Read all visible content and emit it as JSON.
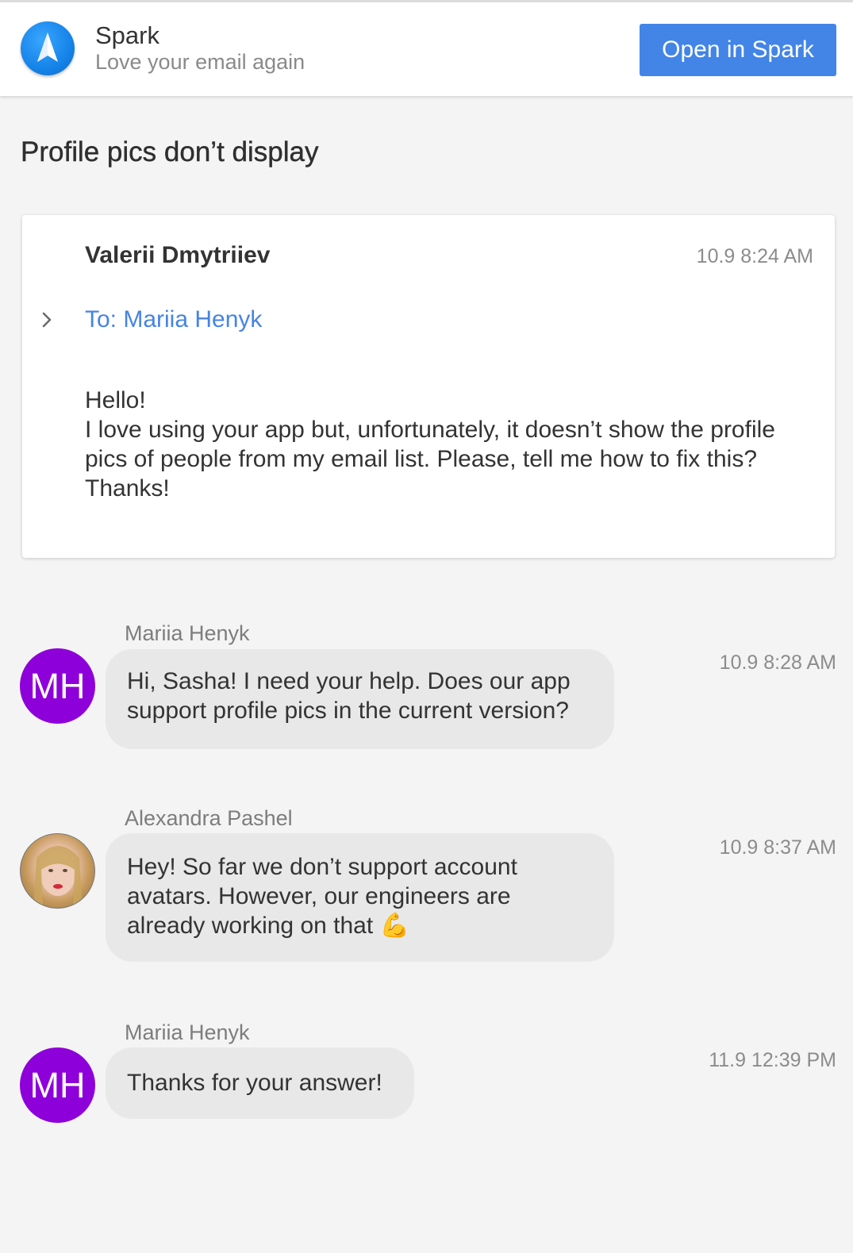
{
  "header": {
    "app_name": "Spark",
    "tagline": "Love your email again",
    "open_button": "Open in Spark",
    "logo_icon": "paper-plane-icon"
  },
  "thread": {
    "subject": "Profile pics don’t display",
    "email": {
      "sender": "Valerii Dmytriiev",
      "time": "10.9 8:24 AM",
      "to": "To: Mariia Henyk",
      "body": [
        "Hello!",
        "I love using your app but, unfortunately, it doesn’t show the profile",
        "pics of people from my email list. Please, tell me how to fix this?",
        "Thanks!"
      ]
    },
    "comments": [
      {
        "author": "Mariia Henyk",
        "initials": "MH",
        "time": "10.9 8:28 AM",
        "lines": [
          "Hi, Sasha! I need your help. Does our app",
          "support profile pics in the current version?"
        ]
      },
      {
        "author": "Alexandra Pashel",
        "time": "10.9 8:37 AM",
        "lines": [
          "Hey! So far we don’t support account",
          "avatars. However, our engineers are",
          "already working on that 💪"
        ]
      },
      {
        "author": "Mariia Henyk",
        "initials": "MH",
        "time": "11.9 12:39 PM",
        "lines": [
          "Thanks for your answer!"
        ]
      }
    ]
  },
  "colors": {
    "accent": "#4285e6",
    "avatar_purple": "#8e00d9",
    "link_blue": "#4584e4"
  }
}
